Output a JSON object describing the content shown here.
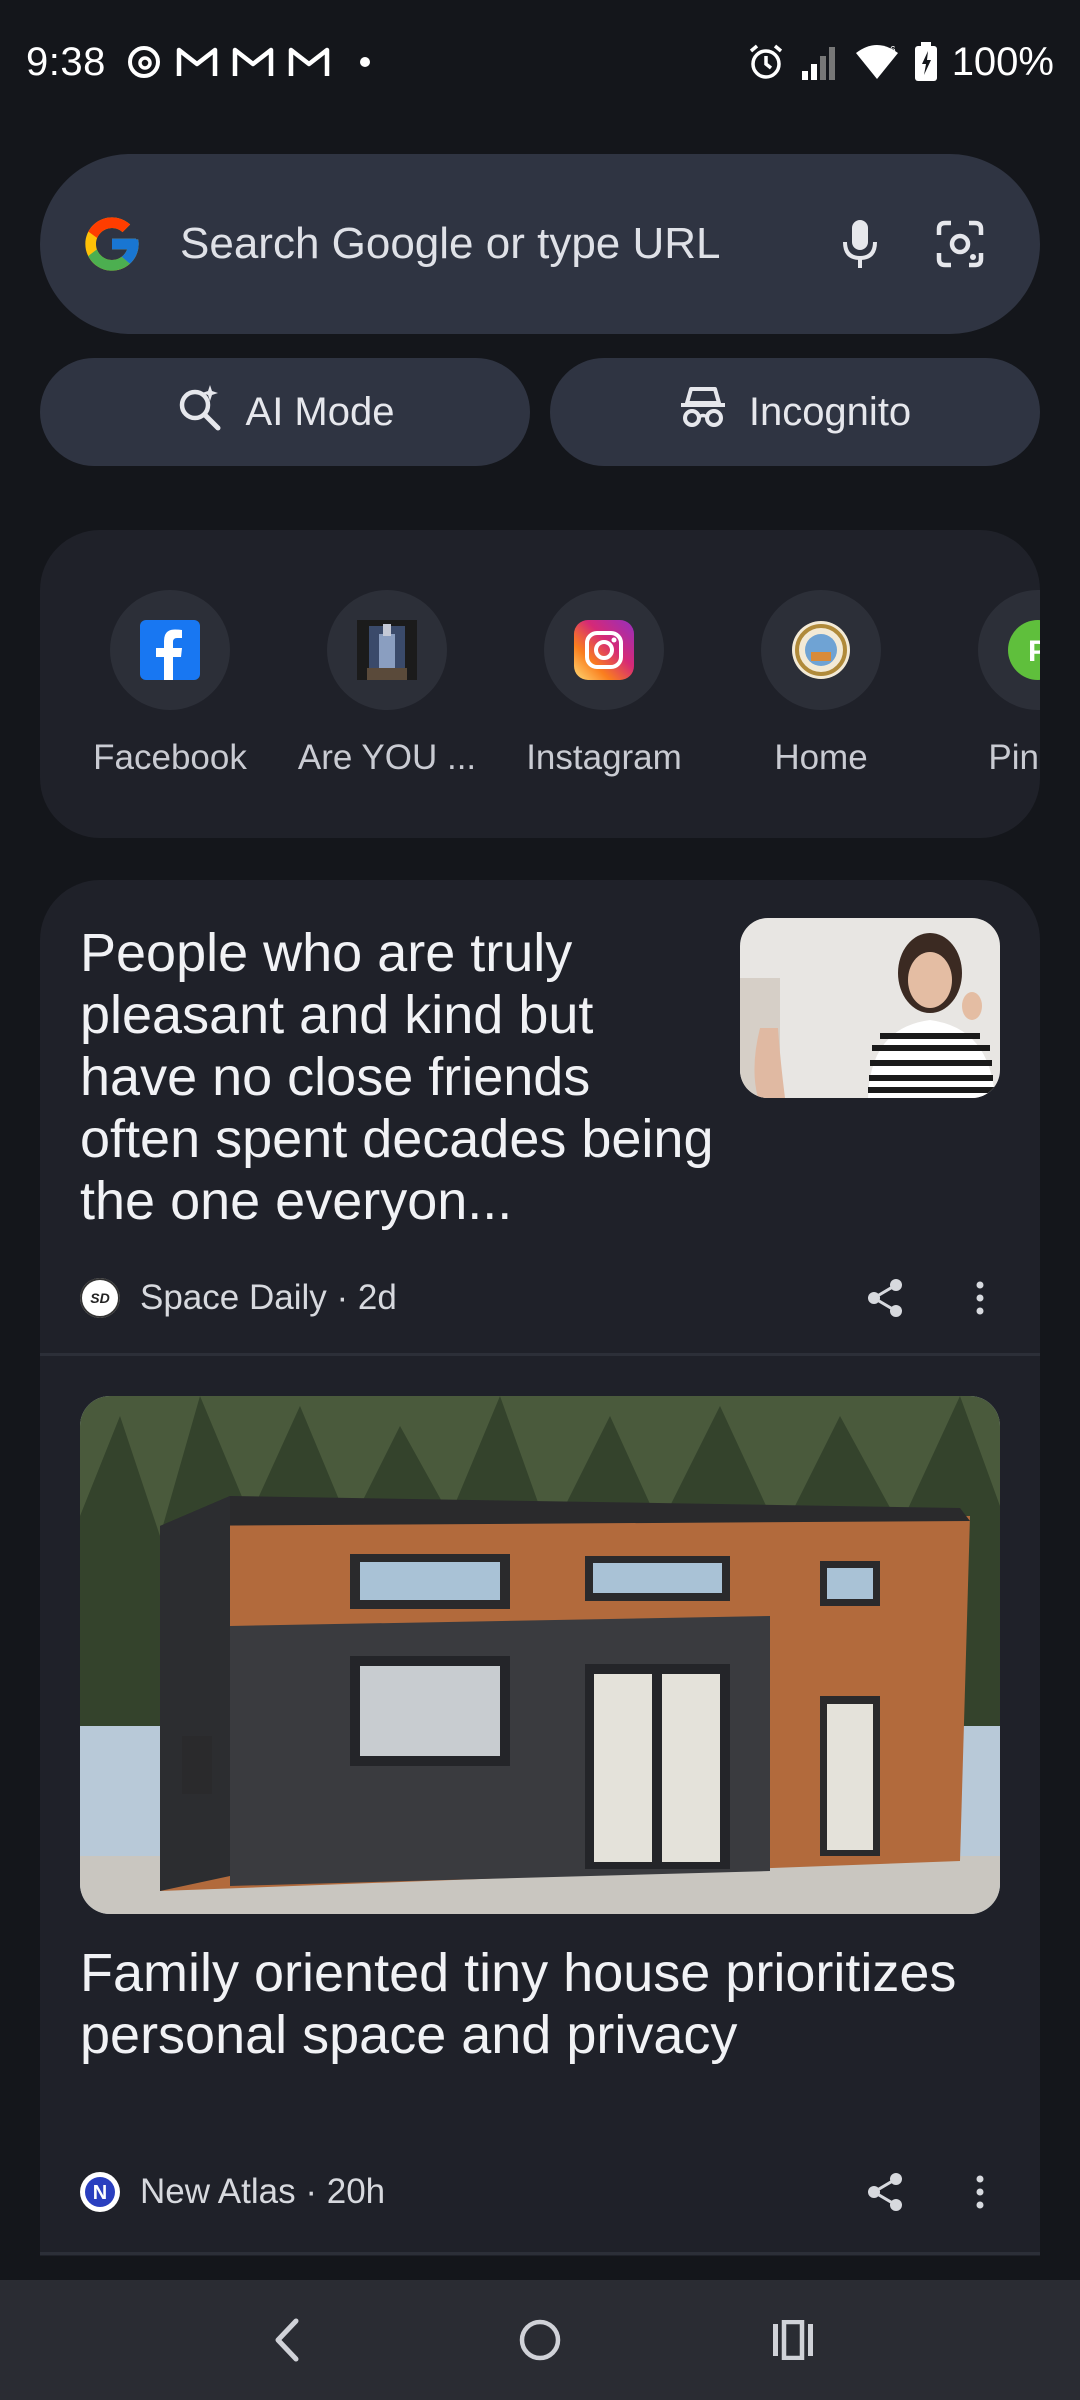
{
  "status_bar": {
    "time": "9:38",
    "battery": "100%",
    "icons": [
      "threads-icon",
      "gmail-icon",
      "gmail-icon",
      "gmail-icon",
      "dot-icon",
      "alarm-icon",
      "signal-icon",
      "wifi-icon",
      "battery-icon"
    ]
  },
  "search": {
    "placeholder": "Search Google or type URL",
    "icons": [
      "google-logo",
      "mic-icon",
      "lens-icon"
    ]
  },
  "modes": {
    "ai_label": "AI Mode",
    "incognito_label": "Incognito"
  },
  "shortcuts": [
    {
      "label": "Facebook",
      "icon": "facebook-icon"
    },
    {
      "label": "Are YOU ...",
      "icon": "site-thumbnail-icon"
    },
    {
      "label": "Instagram",
      "icon": "instagram-icon"
    },
    {
      "label": "Home",
      "icon": "seal-icon"
    },
    {
      "label": "Ping-c",
      "icon": "letter-p-icon"
    }
  ],
  "feed": [
    {
      "headline": "People who are truly pleasant and kind but have no close friends often spent decades being the one everyon...",
      "source": "Space Daily · 2d",
      "source_logo": "SD"
    },
    {
      "headline": "Family oriented tiny house prioritizes personal space and privacy",
      "source": "New Atlas · 20h",
      "source_logo": "N"
    }
  ],
  "colors": {
    "background": "#14161b",
    "surface": "#1f2129",
    "pill": "#2f3442",
    "text": "#f1f2f5"
  }
}
